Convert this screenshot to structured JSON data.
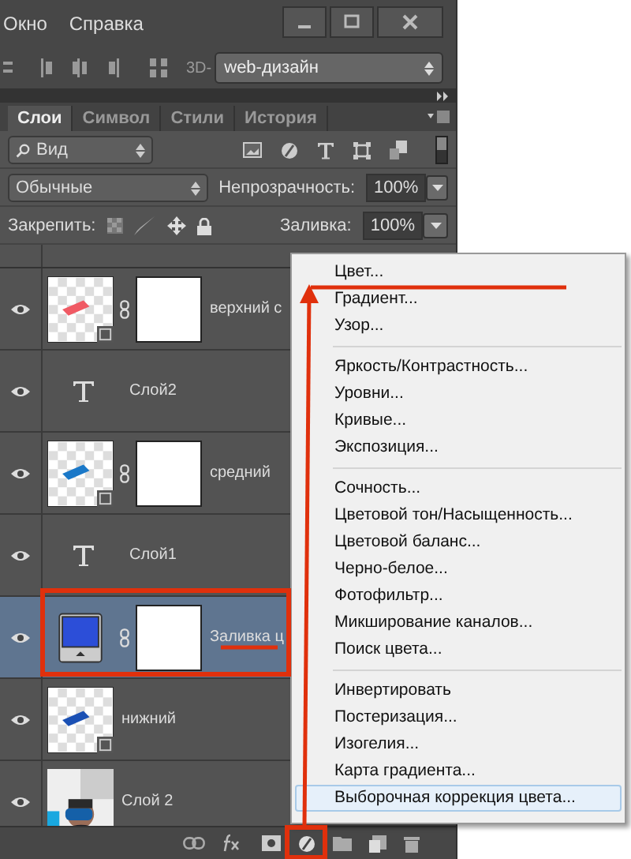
{
  "menu_bar": [
    "Окно",
    "Справка"
  ],
  "toolbar": {
    "prefix": "3D-",
    "workspace": "web-дизайн"
  },
  "tabs": [
    {
      "label": "Слои",
      "selected": true
    },
    {
      "label": "Символ",
      "selected": false
    },
    {
      "label": "Стили",
      "selected": false
    },
    {
      "label": "История",
      "selected": false
    }
  ],
  "filter": {
    "value": "Вид"
  },
  "blend": {
    "mode": "Обычные",
    "opacity_label": "Непрозрачность:",
    "opacity": "100%"
  },
  "lock": {
    "label": "Закрепить:",
    "fill_label": "Заливка:",
    "fill": "100%"
  },
  "layers": [
    {
      "name": "верхний с",
      "kind": "shape",
      "color": "#f05a64",
      "visible": true,
      "selected": false
    },
    {
      "name": "Слой2",
      "kind": "text",
      "visible": true,
      "selected": false
    },
    {
      "name": "средний",
      "kind": "shape",
      "color": "#1a78c8",
      "visible": true,
      "selected": false
    },
    {
      "name": "Слой1",
      "kind": "text",
      "visible": true,
      "selected": false
    },
    {
      "name": "Заливка ц",
      "kind": "fill",
      "visible": true,
      "selected": true
    },
    {
      "name": "нижний",
      "kind": "smart",
      "color": "#1a50b4",
      "visible": true,
      "selected": false
    },
    {
      "name": "Слой 2",
      "visible": true,
      "selected": false
    }
  ],
  "adjustment_menu": {
    "groups": [
      [
        {
          "label": "Цвет...",
          "selected": false
        },
        {
          "label": "Градиент...",
          "selected": false
        },
        {
          "label": "Узор...",
          "selected": false
        }
      ],
      [
        {
          "label": "Яркость/Контрастность...",
          "selected": false
        },
        {
          "label": "Уровни...",
          "selected": false
        },
        {
          "label": "Кривые...",
          "selected": false
        },
        {
          "label": "Экспозиция...",
          "selected": false
        }
      ],
      [
        {
          "label": "Сочность...",
          "selected": false
        },
        {
          "label": "Цветовой тон/Насыщенность...",
          "selected": false
        },
        {
          "label": "Цветовой баланс...",
          "selected": false
        },
        {
          "label": "Черно-белое...",
          "selected": false
        },
        {
          "label": "Фотофильтр...",
          "selected": false
        },
        {
          "label": "Микширование каналов...",
          "selected": false
        },
        {
          "label": "Поиск цвета...",
          "selected": false
        }
      ],
      [
        {
          "label": "Инвертировать",
          "selected": false
        },
        {
          "label": "Постеризация...",
          "selected": false
        },
        {
          "label": "Изогелия...",
          "selected": false
        },
        {
          "label": "Карта градиента...",
          "selected": false
        },
        {
          "label": "Выборочная коррекция цвета...",
          "selected": true
        }
      ]
    ]
  }
}
